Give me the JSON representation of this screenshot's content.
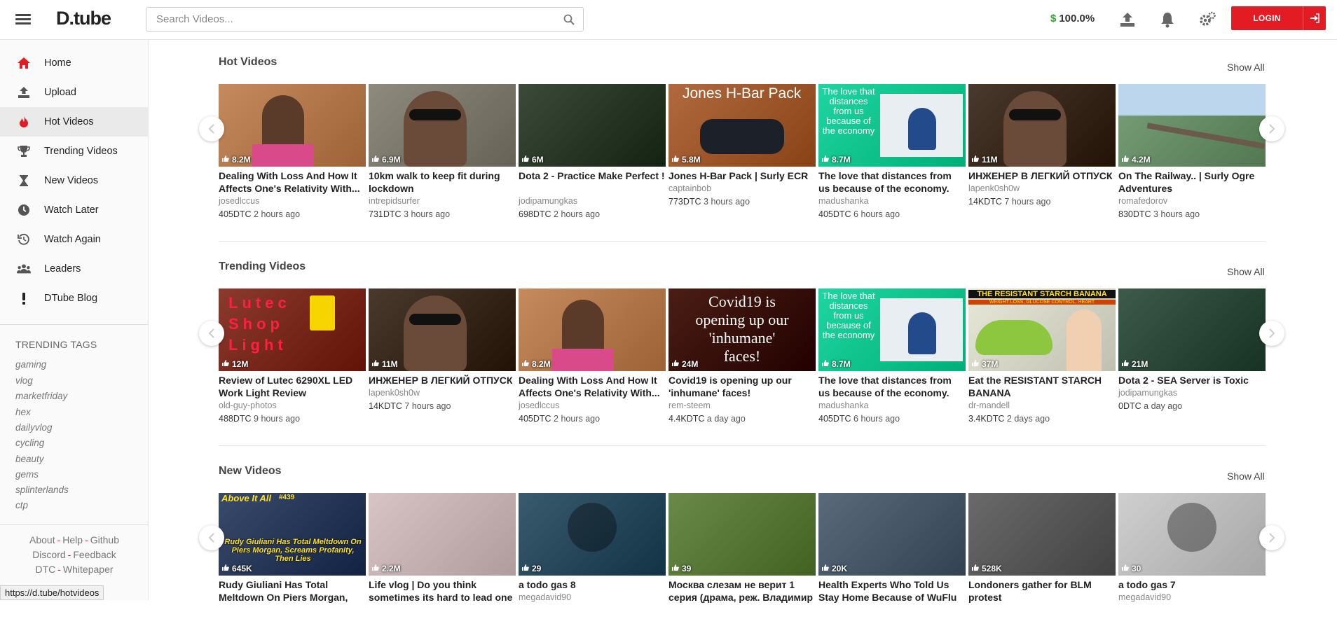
{
  "header": {
    "logo": "D.tube",
    "search_placeholder": "Search Videos...",
    "balance": "100.0%",
    "balance_symbol": "$",
    "login_label": "LOGIN"
  },
  "sidebar": {
    "items": [
      {
        "label": "Home",
        "icon": "home-icon"
      },
      {
        "label": "Upload",
        "icon": "upload-icon"
      },
      {
        "label": "Hot Videos",
        "icon": "flame-icon"
      },
      {
        "label": "Trending Videos",
        "icon": "trophy-icon"
      },
      {
        "label": "New Videos",
        "icon": "hourglass-icon"
      },
      {
        "label": "Watch Later",
        "icon": "clock-icon"
      },
      {
        "label": "Watch Again",
        "icon": "history-icon"
      },
      {
        "label": "Leaders",
        "icon": "users-icon"
      },
      {
        "label": "DTube Blog",
        "icon": "exclamation-icon"
      }
    ],
    "active_item": "Hot Videos",
    "trending_tags_title": "TRENDING TAGS",
    "tags": [
      "gaming",
      "vlog",
      "marketfriday",
      "hex",
      "dailyvlog",
      "cycling",
      "beauty",
      "gems",
      "splinterlands",
      "ctp"
    ],
    "footer": {
      "row1": [
        "About",
        "Help",
        "Github"
      ],
      "row2": [
        "Discord",
        "Feedback"
      ],
      "row3": [
        "DTC",
        "Whitepaper"
      ]
    }
  },
  "sections": [
    {
      "title": "Hot Videos",
      "show_all": "Show All",
      "videos": [
        {
          "views": "8.2M",
          "title": "Dealing With Loss And How It Affects One's Relativity With...",
          "author": "josedlccus",
          "dtc": "405DTC",
          "age": "2 hours ago",
          "bg": "#c58a5d"
        },
        {
          "views": "6.9M",
          "title": "10km walk to keep fit during lockdown",
          "author": "intrepidsurfer",
          "dtc": "731DTC",
          "age": "3 hours ago",
          "bg": "#8e8a7d"
        },
        {
          "views": "6M",
          "title": "Dota 2 - Practice Make Perfect !",
          "author": "jodipamungkas",
          "dtc": "698DTC",
          "age": "2 hours ago",
          "bg": "#3c4a3a"
        },
        {
          "views": "5.8M",
          "title": "Jones H-Bar Pack | Surly ECR",
          "author": "captainbob",
          "dtc": "773DTC",
          "age": "3 hours ago",
          "bg": "#b06a3e"
        },
        {
          "views": "8.7M",
          "title": "The love that distances from us because of the economy.",
          "author": "madushanka",
          "dtc": "405DTC",
          "age": "6 hours ago",
          "bg": "#1fd6a0"
        },
        {
          "views": "11M",
          "title": "ИНЖЕНЕР В ЛЕГКИЙ ОТПУСК",
          "author": "lapenk0sh0w",
          "dtc": "14KDTC",
          "age": "7 hours ago",
          "bg": "#4a3a2e"
        },
        {
          "views": "4.2M",
          "title": "On The Railway.. | Surly Ogre Adventures",
          "author": "romafedorov",
          "dtc": "830DTC",
          "age": "3 hours ago",
          "bg": "#7aa07a"
        }
      ]
    },
    {
      "title": "Trending Videos",
      "show_all": "Show All",
      "videos": [
        {
          "views": "12M",
          "title": "Review of Lutec 6290XL LED Work Light Review",
          "author": "old-guy-photos",
          "dtc": "488DTC",
          "age": "9 hours ago",
          "bg": "#8b3a2e"
        },
        {
          "views": "11M",
          "title": "ИНЖЕНЕР В ЛЕГКИЙ ОТПУСК",
          "author": "lapenk0sh0w",
          "dtc": "14KDTC",
          "age": "7 hours ago",
          "bg": "#4a3a2e"
        },
        {
          "views": "8.2M",
          "title": "Dealing With Loss And How It Affects One's Relativity With...",
          "author": "josedlccus",
          "dtc": "405DTC",
          "age": "2 hours ago",
          "bg": "#c58a5d"
        },
        {
          "views": "24M",
          "title": "Covid19 is opening up our 'inhumane' faces!",
          "author": "rem-steem",
          "dtc": "4.4KDTC",
          "age": "a day ago",
          "bg": "#4a1e14"
        },
        {
          "views": "8.7M",
          "title": "The love that distances from us because of the economy.",
          "author": "madushanka",
          "dtc": "405DTC",
          "age": "6 hours ago",
          "bg": "#1fd6a0"
        },
        {
          "views": "37M",
          "title": "Eat the RESISTANT STARCH BANANA",
          "author": "dr-mandell",
          "dtc": "3.4KDTC",
          "age": "2 days ago",
          "bg": "#e8e8d8"
        },
        {
          "views": "21M",
          "title": "Dota 2 - SEA Server is Toxic",
          "author": "jodipamungkas",
          "dtc": "0DTC",
          "age": "a day ago",
          "bg": "#3e5a4a"
        }
      ]
    },
    {
      "title": "New Videos",
      "show_all": "Show All",
      "videos": [
        {
          "views": "645K",
          "title": "Rudy Giuliani Has Total Meltdown On Piers Morgan, Screams",
          "author": "",
          "dtc": "",
          "age": "",
          "bg": "#3a4a6a"
        },
        {
          "views": "2.2M",
          "title": "Life vlog | Do you think sometimes its hard to lead one",
          "author": "",
          "dtc": "",
          "age": "",
          "bg": "#d8c4c4"
        },
        {
          "views": "29",
          "title": "a todo gas 8",
          "author": "megadavid90",
          "dtc": "",
          "age": "",
          "bg": "#3a5a6e"
        },
        {
          "views": "39",
          "title": "Москва слезам не верит 1 серия (драма, реж. Владимир",
          "author": "",
          "dtc": "",
          "age": "",
          "bg": "#6a8a4a"
        },
        {
          "views": "20K",
          "title": "Health Experts Who Told Us Stay Home Because of WuFlu Now",
          "author": "",
          "dtc": "",
          "age": "",
          "bg": "#5a6a7a"
        },
        {
          "views": "528K",
          "title": "Londoners gather for BLM protest",
          "author": "",
          "dtc": "",
          "age": "",
          "bg": "#6a6a6a"
        },
        {
          "views": "30",
          "title": "a todo gas 7",
          "author": "megadavid90",
          "dtc": "",
          "age": "",
          "bg": "#cfcfcf"
        }
      ]
    }
  ],
  "thumb_text": {
    "hot_3": "Jones H-Bar Pack",
    "love": "The love that distances from us because of the economy",
    "covid": "Covid19 is opening up our 'inhumane' faces!",
    "banana": "THE RESISTANT STARCH BANANA",
    "banana_sub": "WEIGHT LOSS, GLUCOSE CONTROL, HEART",
    "above": "Above It All",
    "above_num": "#439",
    "rudy": "Rudy Giuliani Has Total Meltdown On Piers Morgan, Screams Profanity, Then Lies",
    "lutec": "Lutec Shop Light"
  },
  "status_url": "https://d.tube/hotvideos"
}
